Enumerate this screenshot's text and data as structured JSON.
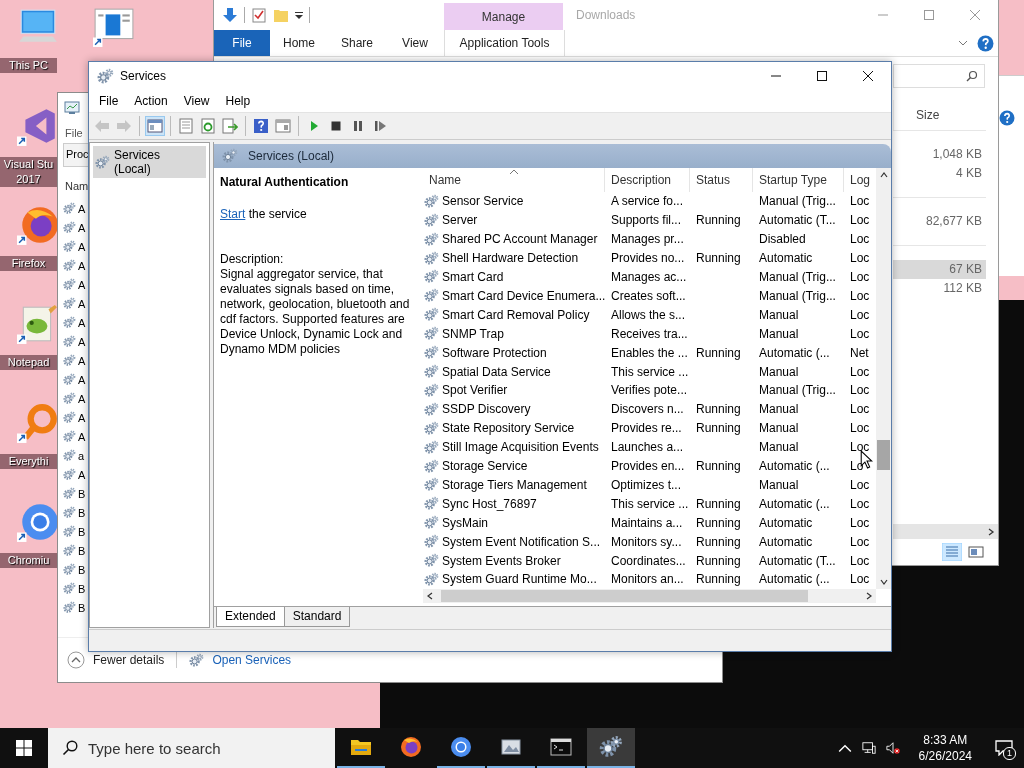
{
  "desktop": {
    "icons": [
      {
        "kind": "computer",
        "label": [
          "This PC"
        ]
      },
      {
        "kind": "window-app"
      },
      {
        "kind": "visual-studio",
        "label": [
          "Visual Stu",
          "2017"
        ]
      },
      {
        "kind": "firefox",
        "label": [
          "Firefox"
        ]
      },
      {
        "kind": "notepad",
        "label": [
          "Notepad"
        ]
      },
      {
        "kind": "everything",
        "label": [
          "Everythi"
        ]
      },
      {
        "kind": "chromium",
        "label": [
          "Chromiu"
        ]
      }
    ]
  },
  "explorer": {
    "title": "Downloads",
    "context_group": "Manage",
    "ribbon_tabs": [
      {
        "label": "File",
        "kind": "file"
      },
      {
        "label": "Home",
        "kind": "tab"
      },
      {
        "label": "Share",
        "kind": "tab"
      },
      {
        "label": "View",
        "kind": "tab"
      },
      {
        "label": "Application Tools",
        "kind": "context"
      }
    ],
    "size_header": "Size",
    "groups": [
      {
        "rows": [
          {
            "size": "1,048 KB",
            "selected": false
          },
          {
            "size": "4 KB",
            "selected": false
          }
        ]
      },
      {
        "rows": [
          {
            "size": "82,677 KB",
            "selected": false
          }
        ]
      },
      {
        "rows": [
          {
            "size": "67 KB",
            "selected": true
          },
          {
            "size": "112 KB",
            "selected": false
          }
        ]
      }
    ]
  },
  "task_manager": {
    "menu": [
      "File"
    ],
    "tab": "Proc",
    "column": "Nam",
    "rows": [
      "A",
      "A",
      "A",
      "A",
      "A",
      "A",
      "A",
      "A",
      "A",
      "A",
      "A",
      "A",
      "A",
      "a",
      "A",
      "B",
      "B",
      "B",
      "B",
      "B",
      "B",
      "B"
    ],
    "fewer_details": "Fewer details",
    "open_services": "Open Services"
  },
  "services": {
    "title": "Services",
    "menu": [
      "File",
      "Action",
      "View",
      "Help"
    ],
    "toolbar": [
      {
        "kind": "back",
        "disabled": true,
        "pressed": false
      },
      {
        "kind": "forward",
        "disabled": true,
        "pressed": false
      },
      {
        "kind": "sep"
      },
      {
        "kind": "tree",
        "disabled": false,
        "pressed": true
      },
      {
        "kind": "sep"
      },
      {
        "kind": "properties",
        "disabled": false,
        "pressed": false
      },
      {
        "kind": "refresh",
        "disabled": false,
        "pressed": false
      },
      {
        "kind": "export",
        "disabled": false,
        "pressed": false
      },
      {
        "kind": "sep"
      },
      {
        "kind": "help",
        "disabled": false,
        "pressed": false
      },
      {
        "kind": "view",
        "disabled": false,
        "pressed": false
      },
      {
        "kind": "sep"
      },
      {
        "kind": "play",
        "disabled": false,
        "pressed": false
      },
      {
        "kind": "stop",
        "disabled": false,
        "pressed": false
      },
      {
        "kind": "pause",
        "disabled": false,
        "pressed": false
      },
      {
        "kind": "restart",
        "disabled": false,
        "pressed": false
      }
    ],
    "tree": [
      {
        "label": "Services (Local)",
        "selected": true
      }
    ],
    "pane_title": "Services (Local)",
    "detail": {
      "title": "Natural Authentication",
      "action_link": "Start",
      "action_text": "the service",
      "description_label": "Description:",
      "description": "Signal aggregator service, that evaluates signals based on time, network, geolocation, bluetooth and cdf factors. Supported features are Device Unlock, Dynamic Lock and Dynamo MDM policies"
    },
    "columns": [
      {
        "label": "Name",
        "sorted": true
      },
      {
        "label": "Description",
        "sorted": false
      },
      {
        "label": "Status",
        "sorted": false
      },
      {
        "label": "Startup Type",
        "sorted": false
      },
      {
        "label": "Log",
        "sorted": false
      }
    ],
    "rows": [
      {
        "name": "Sensor Service",
        "description": "A service fo...",
        "startup": "Manual (Trig...",
        "logon": "Loc"
      },
      {
        "name": "Server",
        "description": "Supports fil...",
        "status": "Running",
        "startup": "Automatic (T...",
        "logon": "Loc"
      },
      {
        "name": "Shared PC Account Manager",
        "description": "Manages pr...",
        "startup": "Disabled",
        "logon": "Loc"
      },
      {
        "name": "Shell Hardware Detection",
        "description": "Provides no...",
        "status": "Running",
        "startup": "Automatic",
        "logon": "Loc"
      },
      {
        "name": "Smart Card",
        "description": "Manages ac...",
        "startup": "Manual (Trig...",
        "logon": "Loc"
      },
      {
        "name": "Smart Card Device Enumera...",
        "description": "Creates soft...",
        "startup": "Manual (Trig...",
        "logon": "Loc"
      },
      {
        "name": "Smart Card Removal Policy",
        "description": "Allows the s...",
        "startup": "Manual",
        "logon": "Loc"
      },
      {
        "name": "SNMP Trap",
        "description": "Receives tra...",
        "startup": "Manual",
        "logon": "Loc"
      },
      {
        "name": "Software Protection",
        "description": "Enables the ...",
        "status": "Running",
        "startup": "Automatic (...",
        "logon": "Net"
      },
      {
        "name": "Spatial Data Service",
        "description": "This service ...",
        "startup": "Manual",
        "logon": "Loc"
      },
      {
        "name": "Spot Verifier",
        "description": "Verifies pote...",
        "startup": "Manual (Trig...",
        "logon": "Loc"
      },
      {
        "name": "SSDP Discovery",
        "description": "Discovers n...",
        "status": "Running",
        "startup": "Manual",
        "logon": "Loc"
      },
      {
        "name": "State Repository Service",
        "description": "Provides re...",
        "status": "Running",
        "startup": "Manual",
        "logon": "Loc"
      },
      {
        "name": "Still Image Acquisition Events",
        "description": "Launches a...",
        "startup": "Manual",
        "logon": "Loc"
      },
      {
        "name": "Storage Service",
        "description": "Provides en...",
        "status": "Running",
        "startup": "Automatic (...",
        "logon": "Lo"
      },
      {
        "name": "Storage Tiers Management",
        "description": "Optimizes t...",
        "startup": "Manual",
        "logon": "Loc"
      },
      {
        "name": "Sync Host_76897",
        "description": "This service ...",
        "status": "Running",
        "startup": "Automatic (...",
        "logon": "Loc"
      },
      {
        "name": "SysMain",
        "description": "Maintains a...",
        "status": "Running",
        "startup": "Automatic",
        "logon": "Loc"
      },
      {
        "name": "System Event Notification S...",
        "description": "Monitors sy...",
        "status": "Running",
        "startup": "Automatic",
        "logon": "Loc"
      },
      {
        "name": "System Events Broker",
        "description": "Coordinates...",
        "status": "Running",
        "startup": "Automatic (T...",
        "logon": "Loc"
      },
      {
        "name": "System Guard Runtime Mo...",
        "description": "Monitors an...",
        "status": "Running",
        "startup": "Automatic (...",
        "logon": "Loc"
      }
    ],
    "tabs": [
      {
        "label": "Extended",
        "selected": true
      },
      {
        "label": "Standard",
        "selected": false
      }
    ]
  },
  "taskbar": {
    "search_placeholder": "Type here to search",
    "apps": [
      {
        "kind": "folder",
        "running": true,
        "selected": false
      },
      {
        "kind": "firefox",
        "running": false,
        "selected": false
      },
      {
        "kind": "chromium",
        "running": true,
        "selected": false
      },
      {
        "kind": "photos",
        "running": true,
        "selected": false
      },
      {
        "kind": "terminal",
        "running": true,
        "selected": false
      },
      {
        "kind": "services",
        "running": true,
        "selected": true
      }
    ],
    "time": "8:33 AM",
    "date": "6/26/2024",
    "notifications": "1"
  }
}
